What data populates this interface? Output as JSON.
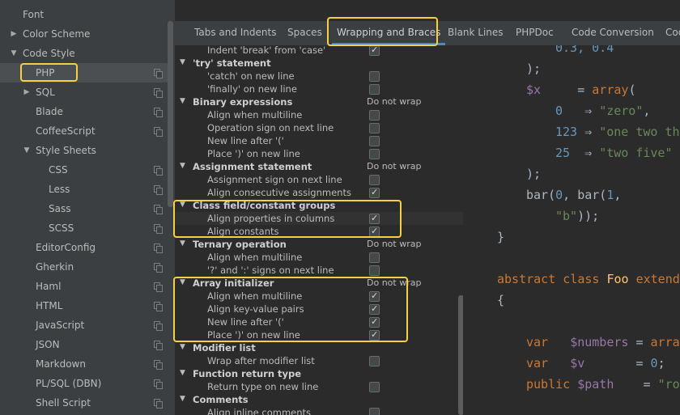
{
  "sidebar": {
    "font_label": "Font",
    "color_scheme_label": "Color Scheme",
    "code_style_label": "Code Style",
    "items": [
      {
        "label": "PHP"
      },
      {
        "label": "SQL"
      },
      {
        "label": "Blade"
      },
      {
        "label": "CoffeeScript"
      },
      {
        "label": "Style Sheets"
      },
      {
        "label": "CSS"
      },
      {
        "label": "Less"
      },
      {
        "label": "Sass"
      },
      {
        "label": "SCSS"
      },
      {
        "label": "EditorConfig"
      },
      {
        "label": "Gherkin"
      },
      {
        "label": "Haml"
      },
      {
        "label": "HTML"
      },
      {
        "label": "JavaScript"
      },
      {
        "label": "JSON"
      },
      {
        "label": "Markdown"
      },
      {
        "label": "PL/SQL (DBN)"
      },
      {
        "label": "Shell Script"
      }
    ]
  },
  "tabs": [
    {
      "label": "Tabs and Indents"
    },
    {
      "label": "Spaces"
    },
    {
      "label": "Wrapping and Braces"
    },
    {
      "label": "Blank Lines"
    },
    {
      "label": "PHPDoc"
    },
    {
      "label": "Code Conversion"
    },
    {
      "label": "Cod"
    }
  ],
  "settings": [
    {
      "label": "Indent 'break' from 'case'",
      "checked": true
    },
    {
      "label": "'try' statement"
    },
    {
      "label": "'catch' on new line",
      "checked": false
    },
    {
      "label": "'finally' on new line",
      "checked": false
    },
    {
      "label": "Binary expressions",
      "value": "Do not wrap"
    },
    {
      "label": "Align when multiline",
      "checked": false
    },
    {
      "label": "Operation sign on next line",
      "checked": false
    },
    {
      "label": "New line after '('",
      "checked": false
    },
    {
      "label": "Place ')' on new line",
      "checked": false
    },
    {
      "label": "Assignment statement",
      "value": "Do not wrap"
    },
    {
      "label": "Assignment sign on next line",
      "checked": false
    },
    {
      "label": "Align consecutive assignments",
      "checked": true
    },
    {
      "label": "Class field/constant groups"
    },
    {
      "label": "Align properties in columns",
      "checked": true
    },
    {
      "label": "Align constants",
      "checked": true
    },
    {
      "label": "Ternary operation",
      "value": "Do not wrap"
    },
    {
      "label": "Align when multiline",
      "checked": false
    },
    {
      "label": "'?' and ':' signs on next line",
      "checked": false
    },
    {
      "label": "Array initializer",
      "value": "Do not wrap"
    },
    {
      "label": "Align when multiline",
      "checked": true
    },
    {
      "label": "Align key-value pairs",
      "checked": true
    },
    {
      "label": "New line after '('",
      "checked": true
    },
    {
      "label": "Place ')' on new line",
      "checked": true
    },
    {
      "label": "Modifier list"
    },
    {
      "label": "Wrap after modifier list",
      "checked": false
    },
    {
      "label": "Function return type"
    },
    {
      "label": "Return type on new line",
      "checked": false
    },
    {
      "label": "Comments"
    },
    {
      "label": "Align inline comments",
      "checked": false
    }
  ],
  "code": {
    "l01": {
      "a": "0.3, 0.4"
    },
    "l02": {
      "a": ");"
    },
    "l03": {
      "v": "$x",
      "a": "     = ",
      "k": "array",
      "b": "("
    },
    "l04": {
      "n": "0",
      "a": "   ⇒ ",
      "s": "\"zero\"",
      "b": ","
    },
    "l05": {
      "n": "123",
      "a": " ⇒ ",
      "s": "\"one two three\""
    },
    "l06": {
      "n": "25",
      "a": "  ⇒ ",
      "s": "\"two five\""
    },
    "l07": {
      "a": ");"
    },
    "l08": {
      "a": "bar(",
      "n1": "0",
      "b": ", bar(",
      "n2": "1",
      "c": ","
    },
    "l09": {
      "s": "\"b\"",
      "a": "));"
    },
    "l10": {
      "a": "}"
    },
    "l11": {
      "k1": "abstract",
      "k2": "class",
      "f": "Foo",
      "k3": "extends"
    },
    "l12": {
      "a": "{"
    },
    "l13": {
      "k": "var",
      "v": "$numbers",
      "a": " = ",
      "k2": "array"
    },
    "l14": {
      "k": "var",
      "v": "$v",
      "a": "       = ",
      "n": "0",
      "b": ";"
    },
    "l15": {
      "k": "public",
      "v": "$path",
      "a": "    = ",
      "s": "\"root\""
    }
  }
}
